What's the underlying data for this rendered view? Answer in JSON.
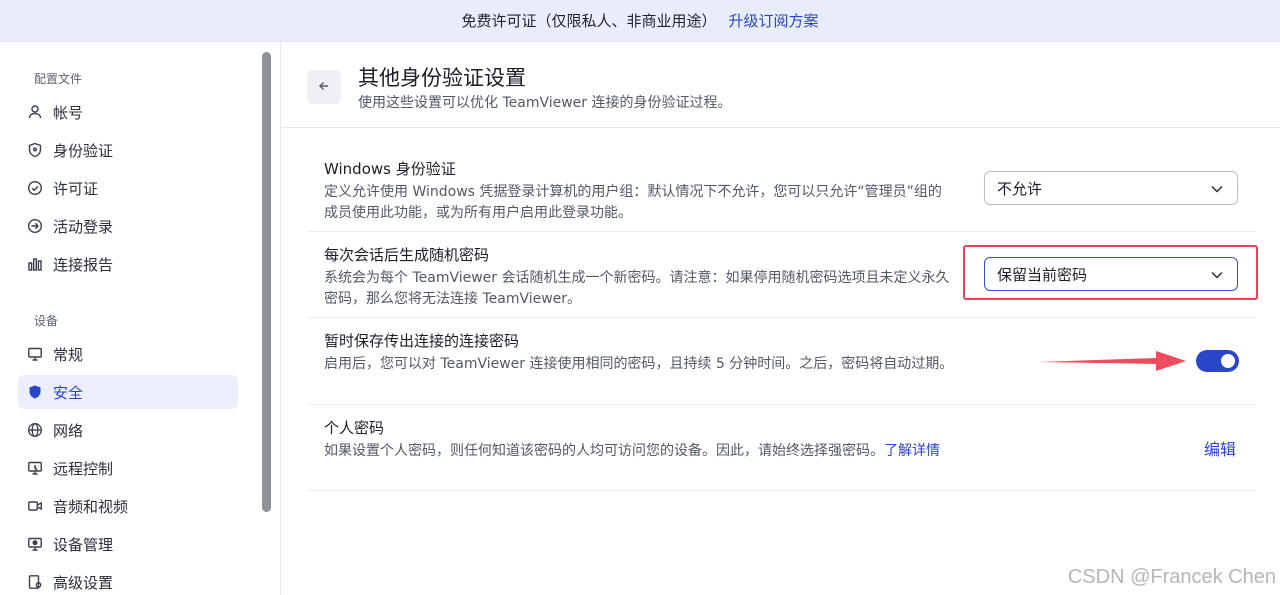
{
  "banner": {
    "text": "免费许可证（仅限私人、非商业用途）",
    "link": "升级订阅方案"
  },
  "sidebar": {
    "profile_section": "配置文件",
    "device_section": "设备",
    "items": [
      {
        "label": "帐号",
        "icon": "user-icon"
      },
      {
        "label": "身份验证",
        "icon": "shield-icon"
      },
      {
        "label": "许可证",
        "icon": "badge-check-icon"
      },
      {
        "label": "活动登录",
        "icon": "login-arrow-icon"
      },
      {
        "label": "连接报告",
        "icon": "bar-chart-icon"
      },
      {
        "label": "常规",
        "icon": "monitor-icon"
      },
      {
        "label": "安全",
        "icon": "shield-filled-icon",
        "active": true
      },
      {
        "label": "网络",
        "icon": "globe-icon"
      },
      {
        "label": "远程控制",
        "icon": "remote-control-icon"
      },
      {
        "label": "音频和视频",
        "icon": "video-icon"
      },
      {
        "label": "设备管理",
        "icon": "device-manage-icon"
      },
      {
        "label": "高级设置",
        "icon": "advanced-settings-icon"
      }
    ]
  },
  "header": {
    "title": "其他身份验证设置",
    "subtitle": "使用这些设置可以优化 TeamViewer 连接的身份验证过程。"
  },
  "settings": {
    "windows_auth": {
      "title": "Windows 身份验证",
      "desc": "定义允许使用 Windows 凭据登录计算机的用户组：默认情况下不允许，您可以只允许“管理员”组的成员使用此功能，或为所有用户启用此登录功能。",
      "value": "不允许"
    },
    "random_password": {
      "title": "每次会话后生成随机密码",
      "desc": "系统会为每个 TeamViewer 会话随机生成一个新密码。请注意：如果停用随机密码选项且未定义永久密码，那么您将无法连接 TeamViewer。",
      "value": "保留当前密码"
    },
    "temp_save": {
      "title": "暂时保存传出连接的连接密码",
      "desc": "启用后，您可以对 TeamViewer 连接使用相同的密码，且持续 5 分钟时间。之后，密码将自动过期。",
      "enabled": true
    },
    "personal_password": {
      "title": "个人密码",
      "desc": "如果设置个人密码，则任何知道该密码的人均可访问您的设备。因此，请始终选择强密码。",
      "learn_more": "了解详情",
      "edit": "编辑"
    }
  },
  "watermark": "CSDN @Francek Chen",
  "colors": {
    "accent": "#2a45c8",
    "highlight": "#e64356",
    "arrow": "#ef4d5f"
  }
}
